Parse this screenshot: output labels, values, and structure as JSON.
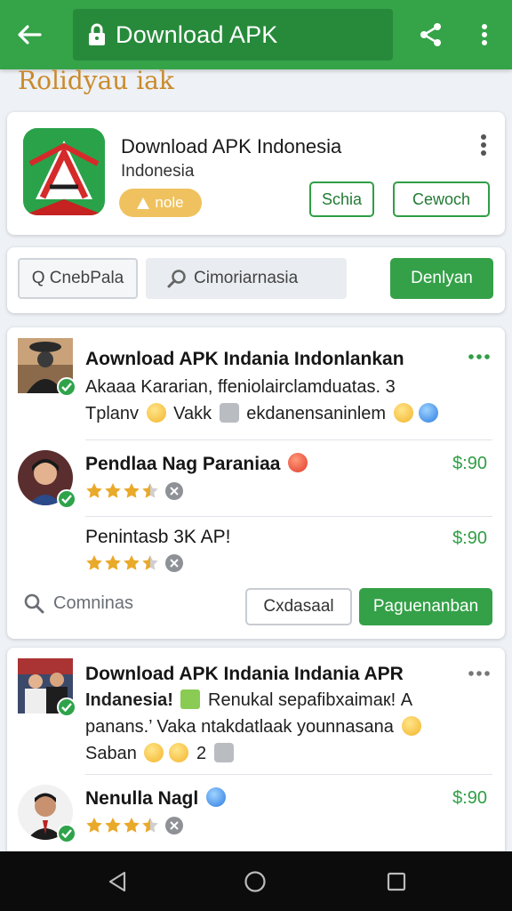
{
  "toolbar": {
    "url_text": "Download APK"
  },
  "site_title": "Rolidyau iak",
  "app": {
    "name": "Download APK Indonesia",
    "subtitle": "Indonesia",
    "badge": "nole",
    "button1": "Schia",
    "button2": "Cewoch"
  },
  "search": {
    "chip1": "Q CnebPala",
    "chip2": "Cimoriarnasia",
    "go": "Denlyan"
  },
  "feed1": {
    "post": {
      "title": "Aownload APK Indania Indonlankan",
      "line1": "Akaaa Kararian, ffeniolairclamduatas. 3",
      "line2a": "Tplanv",
      "line2b": "Vakk",
      "line2c": "ekdanensaninlem"
    },
    "item1": {
      "title": "Pendlaa Nag Paraniaa",
      "price": "$:90",
      "rating": 3.5
    },
    "item2": {
      "title": "Penintasb 3K AP!",
      "price": "$:90",
      "rating": 3.5
    },
    "comment_placeholder": "Comninas",
    "button_secondary": "Cxdasaal",
    "button_primary": "Paguenanban"
  },
  "feed2": {
    "post": {
      "line1": "Download APK Indania Indania APR",
      "line2a": "Indanesia!",
      "line2b": "Renukal sepafibxaimaк! A",
      "line3": "panans.’ Vaka ntakdatlaak younnasana",
      "line4a": "Saban",
      "line4b": "2"
    },
    "item1": {
      "title": "Nenulla Nagl",
      "price": "$:90",
      "rating": 3.5
    }
  },
  "colors": {
    "brand_green": "#35a348",
    "accent_gold": "#efc25f",
    "price_green": "#2f9e45"
  }
}
